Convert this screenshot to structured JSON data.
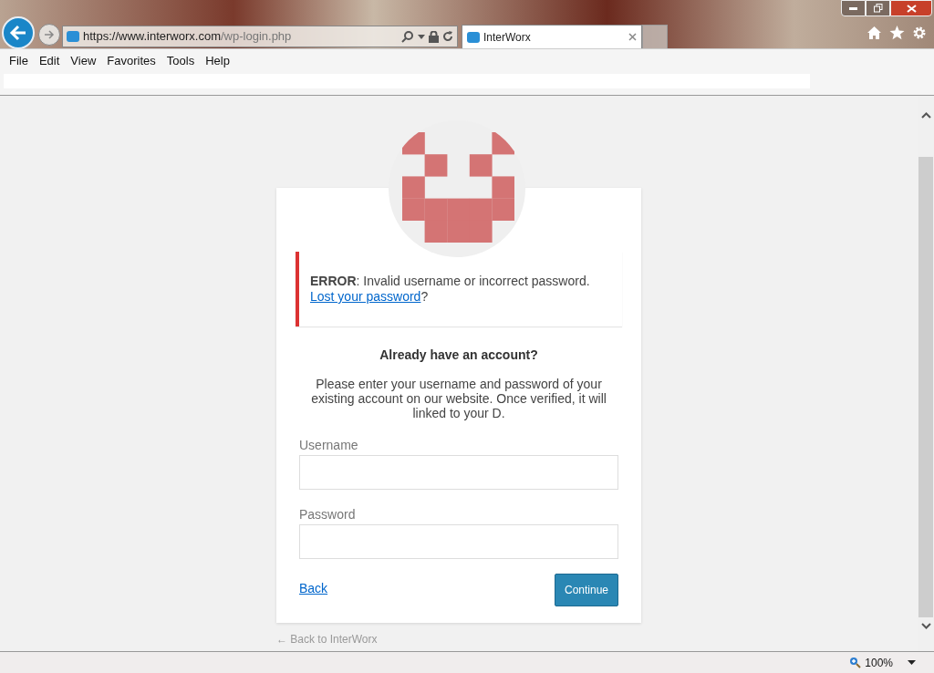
{
  "browser": {
    "url_host": "https://www.interworx.com",
    "url_path": "/wp-login.php",
    "tab": {
      "title": "InterWorx",
      "selected": true
    },
    "menu": [
      "File",
      "Edit",
      "View",
      "Favorites",
      "Tools",
      "Help"
    ],
    "zoom": "100%"
  },
  "login": {
    "error": {
      "message": "**ERROR**: Invalid username or incorrect password.",
      "link": "Lost your password",
      "suffix": "?"
    },
    "heading": "Already have an account?",
    "intro": "Please enter your username and password of your existing account on our website. Once verified, it will linked to your D.",
    "fields": [
      {
        "label": "Username"
      },
      {
        "label": "Password"
      }
    ],
    "back": "Back",
    "submit": "Continue"
  },
  "footer_link": "← Back to InterWorx"
}
